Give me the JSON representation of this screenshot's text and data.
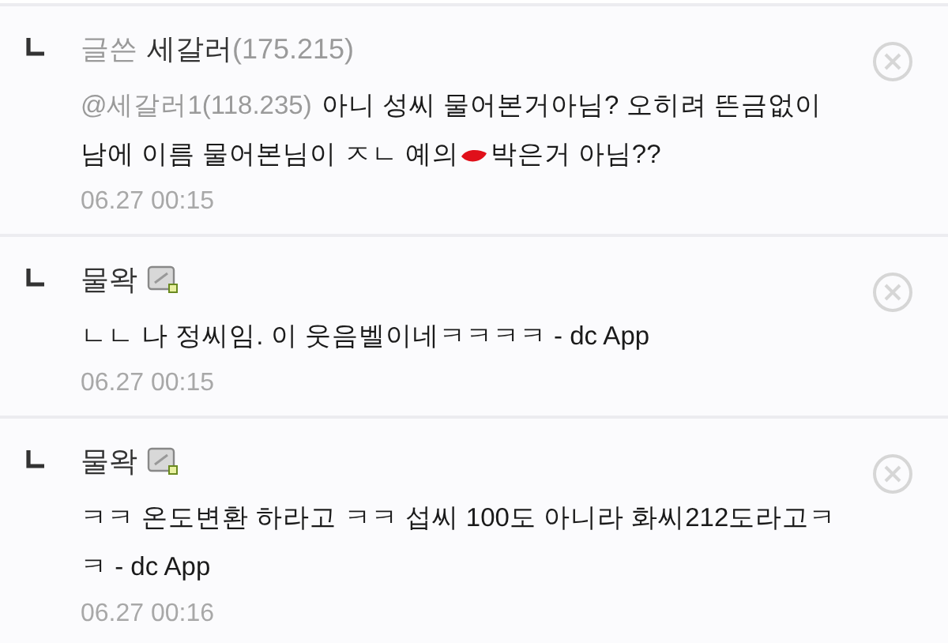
{
  "comments": [
    {
      "author_label": "글쓴",
      "author": "세갈러",
      "author_ip": "(175.215)",
      "has_user_icon": false,
      "mention": "@세갈러1(118.235)",
      "body": [
        "아니 성씨 물어본거아님? 오히려 뜬금없이 남에 이름 물어본님이 ㅈㄴ 예의",
        "박은거 아님??"
      ],
      "time": "06.27 00:15"
    },
    {
      "author": "물왁",
      "has_user_icon": true,
      "body": [
        "ㄴㄴ 나 정씨임. 이 웃음벨이네ㅋㅋㅋㅋ - dc App"
      ],
      "time": "06.27 00:15"
    },
    {
      "author": "물왁",
      "has_user_icon": true,
      "body": [
        "ㅋㅋ 온도변환 하라고 ㅋㅋ 섭씨 100도 아니라 화씨212도라고ㅋㅋ - dc App"
      ],
      "time": "06.27 00:16"
    }
  ]
}
